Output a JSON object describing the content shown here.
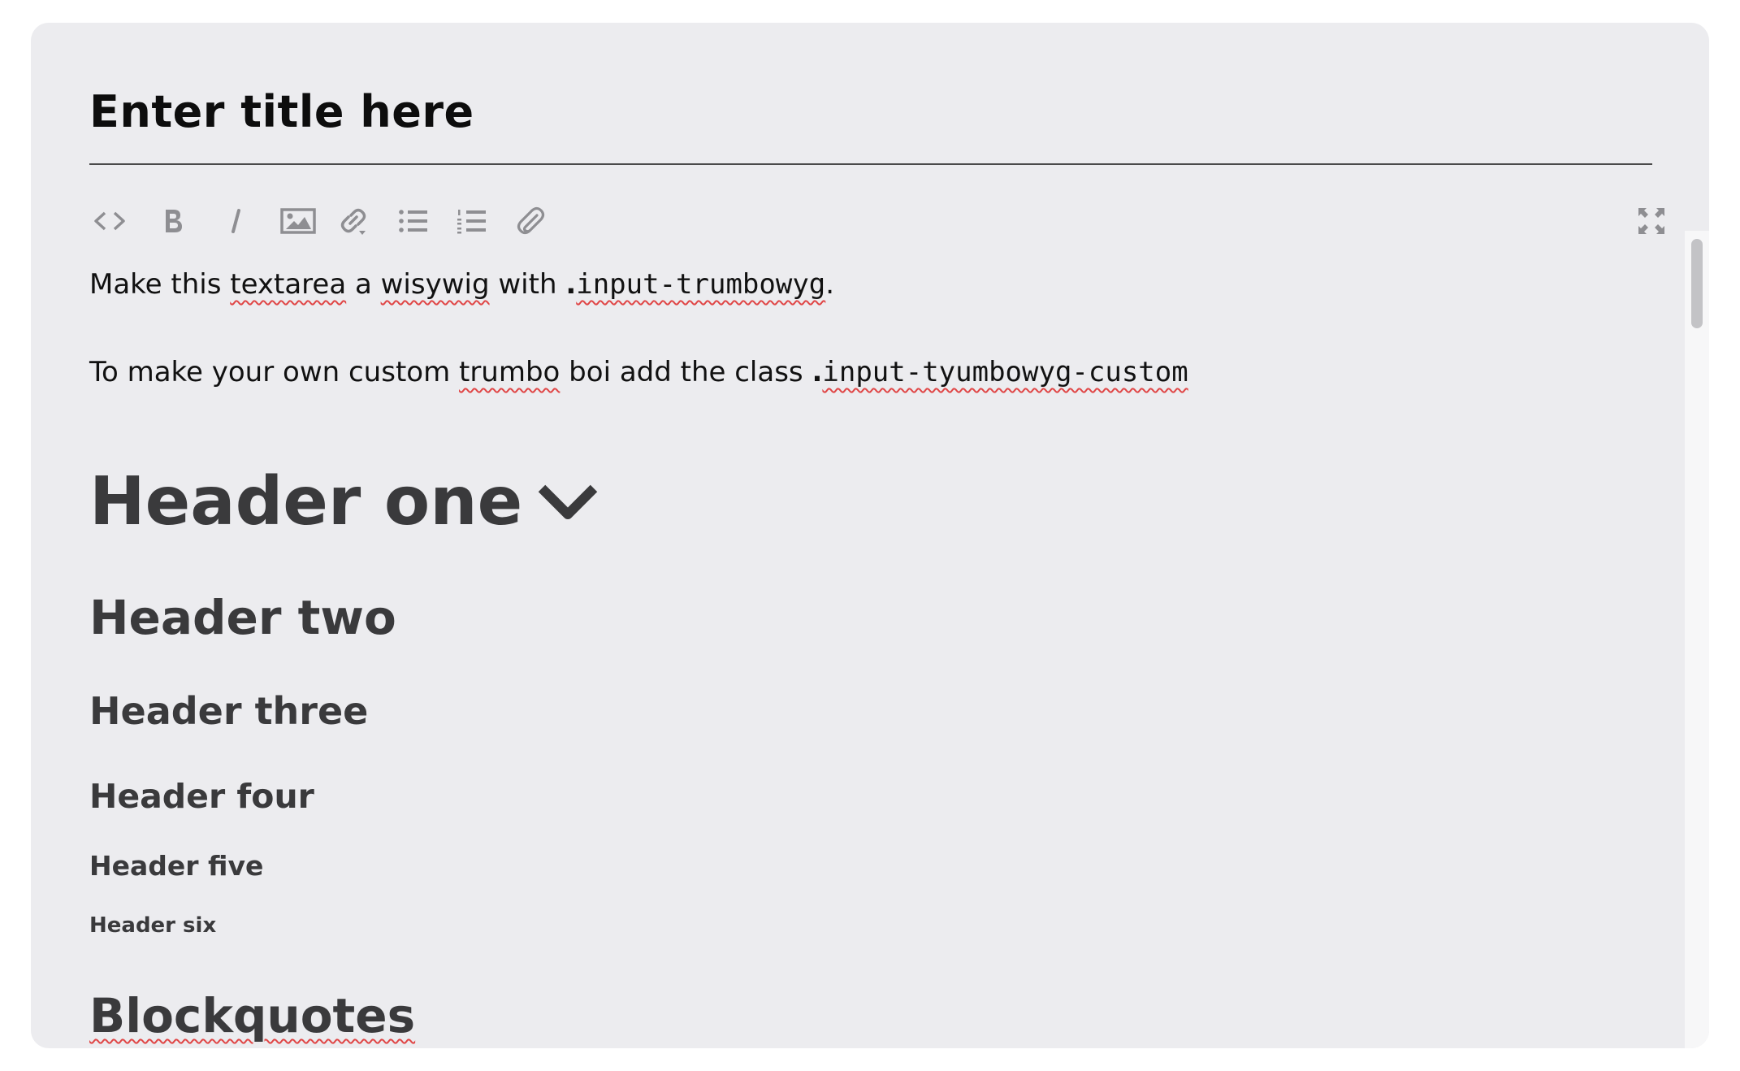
{
  "editor": {
    "title_placeholder": "Enter title here"
  },
  "toolbar": {
    "buttons": [
      {
        "name": "view-html",
        "icon": "code-icon"
      },
      {
        "name": "bold",
        "label": "B",
        "icon": "bold-icon"
      },
      {
        "name": "italic",
        "label": "I",
        "icon": "italic-icon"
      },
      {
        "name": "insert-image",
        "icon": "image-icon"
      },
      {
        "name": "link",
        "icon": "link-icon"
      },
      {
        "name": "unordered-list",
        "icon": "unordered-list-icon"
      },
      {
        "name": "ordered-list",
        "icon": "ordered-list-icon"
      },
      {
        "name": "attach",
        "icon": "paperclip-icon"
      },
      {
        "name": "fullscreen",
        "icon": "fullscreen-icon"
      }
    ]
  },
  "content": {
    "p1": {
      "t1": "Make this ",
      "w1": "textarea",
      "t2": " a ",
      "w2": "wisywig",
      "t3": " with ",
      "dot": ".",
      "code": "input-trumbowyg",
      "end": "."
    },
    "p2": {
      "t1": "To make your own custom ",
      "w1": "trumbo",
      "t2": " boi add the class ",
      "dot": ".",
      "code": "input-tyumbowyg-custom"
    },
    "headers": {
      "h1": "Header one",
      "h2": "Header two",
      "h3": "Header three",
      "h4": "Header four",
      "h5": "Header five",
      "h6": "Header six",
      "blockquotes": "Blockquotes"
    }
  },
  "colors": {
    "card_bg": "#ececef",
    "icon": "#8e8e92",
    "heading": "#3a3a3c",
    "spellcheck": "#e04646"
  }
}
